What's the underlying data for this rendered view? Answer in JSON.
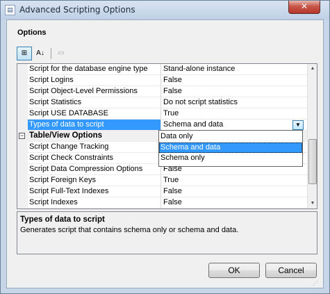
{
  "window": {
    "title": "Advanced Scripting Options",
    "close_label": "✕"
  },
  "section_label": "Options",
  "toolbar": {
    "categorized_icon": "⊞",
    "alphabetical_label": "A↓",
    "pages_icon": "▭"
  },
  "grid": {
    "rows": [
      {
        "name": "Script for the database engine type",
        "value": "Stand-alone instance"
      },
      {
        "name": "Script Logins",
        "value": "False"
      },
      {
        "name": "Script Object-Level Permissions",
        "value": "False"
      },
      {
        "name": "Script Statistics",
        "value": "Do not script statistics"
      },
      {
        "name": "Script USE DATABASE",
        "value": "True"
      },
      {
        "name": "Types of data to script",
        "value": "Schema and data"
      },
      {
        "name": "Table/View Options",
        "expander": "−"
      },
      {
        "name": "Script Change Tracking",
        "value": ""
      },
      {
        "name": "Script Check Constraints",
        "value": ""
      },
      {
        "name": "Script Data Compression Options",
        "value": "False"
      },
      {
        "name": "Script Foreign Keys",
        "value": "True"
      },
      {
        "name": "Script Full-Text Indexes",
        "value": "False"
      },
      {
        "name": "Script Indexes",
        "value": "False"
      }
    ],
    "dropdown_arrow": "▼"
  },
  "dropdown": {
    "options": [
      "Data only",
      "Schema and data",
      "Schema only"
    ],
    "selected": "Schema and data"
  },
  "description": {
    "title": "Types of data to script",
    "text": "Generates script that contains schema only or schema and data."
  },
  "buttons": {
    "ok": "OK",
    "cancel": "Cancel"
  },
  "colors": {
    "selection": "#3399ff",
    "title_bar": "#c6d5e8",
    "close_button": "#c9564a"
  }
}
